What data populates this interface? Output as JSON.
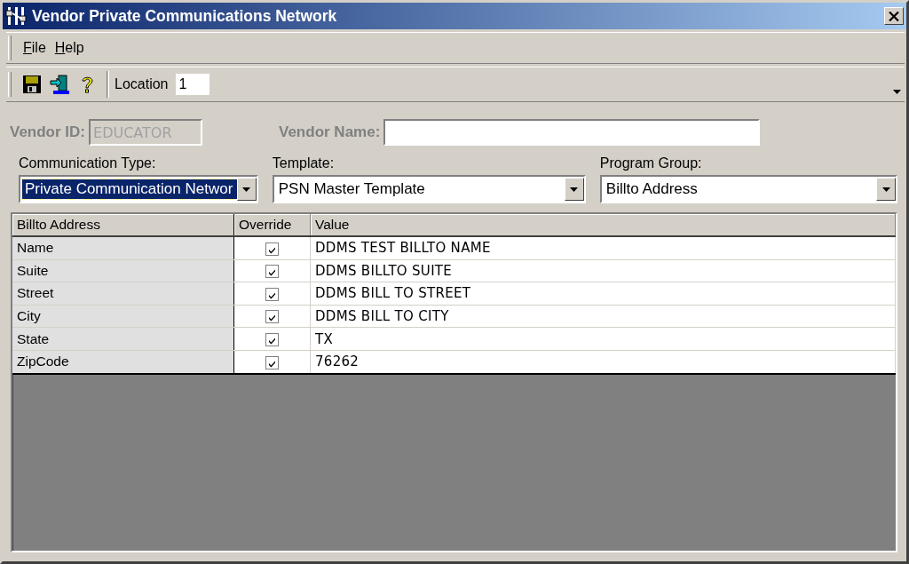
{
  "window": {
    "title": "Vendor Private Communications Network"
  },
  "menu": [
    {
      "label": "File"
    },
    {
      "label": "Help"
    }
  ],
  "toolbar": {
    "location_label": "Location",
    "location_value": "1"
  },
  "vendor": {
    "disabled": true,
    "id_label": "Vendor ID:",
    "id_value": "EDUCATOR",
    "name_label": "Vendor Name:"
  },
  "selectors": [
    {
      "label": "Communication Type:",
      "value": "Private Communication Networ",
      "focused": true
    },
    {
      "label": "Template:",
      "value": "PSN Master Template",
      "focused": false
    },
    {
      "label": "Program Group:",
      "value": "Billto Address",
      "focused": false
    }
  ],
  "grid": {
    "columns": [
      "Billto Address",
      "Override",
      "Value"
    ],
    "rows": [
      {
        "field": "Name",
        "override": true,
        "value": "DDMS TEST BILLTO NAME"
      },
      {
        "field": "Suite",
        "override": true,
        "value": "DDMS BILLTO SUITE"
      },
      {
        "field": "Street",
        "override": true,
        "value": "DDMS BILL TO STREET"
      },
      {
        "field": "City",
        "override": true,
        "value": "DDMS BILL TO CITY"
      },
      {
        "field": "State",
        "override": true,
        "value": "TX"
      },
      {
        "field": "ZipCode",
        "override": true,
        "value": "76262"
      }
    ]
  }
}
